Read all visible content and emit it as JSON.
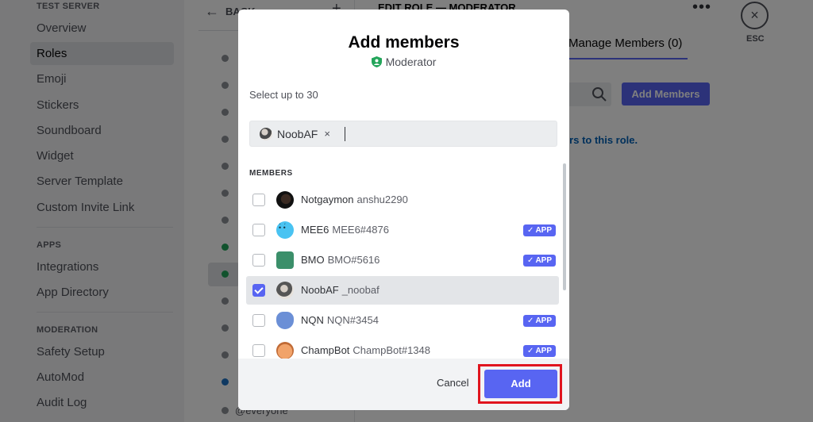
{
  "sidebar": {
    "server_heading": "TEST SERVER",
    "items_top": [
      "Overview",
      "Roles",
      "Emoji",
      "Stickers",
      "Soundboard",
      "Widget",
      "Server Template",
      "Custom Invite Link"
    ],
    "apps_heading": "APPS",
    "apps_items": [
      "Integrations",
      "App Directory"
    ],
    "moderation_heading": "MODERATION",
    "moderation_items": [
      "Safety Setup",
      "AutoMod",
      "Audit Log"
    ]
  },
  "main": {
    "back_label": "BACK",
    "plus_icon": "+",
    "edit_title": "EDIT ROLE — MODERATOR",
    "more_icon": "•••",
    "tab_manage": "Manage Members (0)",
    "add_members_label": "Add Members",
    "role_hint": "bers to this role.",
    "everyone_label": "@everyone"
  },
  "esc": {
    "icon": "×",
    "label": "ESC"
  },
  "modal": {
    "title": "Add members",
    "subtitle": "Moderator",
    "select_hint": "Select up to 30",
    "chip_name": "NoobAF",
    "chip_remove": "×",
    "members_heading": "MEMBERS",
    "members": [
      {
        "name": "Notgaymon",
        "username": "anshu2290",
        "app": false,
        "checked": false
      },
      {
        "name": "MEE6",
        "username": "MEE6#4876",
        "app": true,
        "checked": false
      },
      {
        "name": "BMO",
        "username": "BMO#5616",
        "app": true,
        "checked": false
      },
      {
        "name": "NoobAF",
        "username": "_noobaf",
        "app": false,
        "checked": true
      },
      {
        "name": "NQN",
        "username": "NQN#3454",
        "app": true,
        "checked": false
      },
      {
        "name": "ChampBot",
        "username": "ChampBot#1348",
        "app": true,
        "checked": false
      }
    ],
    "app_badge": "APP",
    "cancel_label": "Cancel",
    "add_label": "Add"
  },
  "colors": {
    "accent": "#5865f2",
    "highlight": "#e0141e"
  }
}
